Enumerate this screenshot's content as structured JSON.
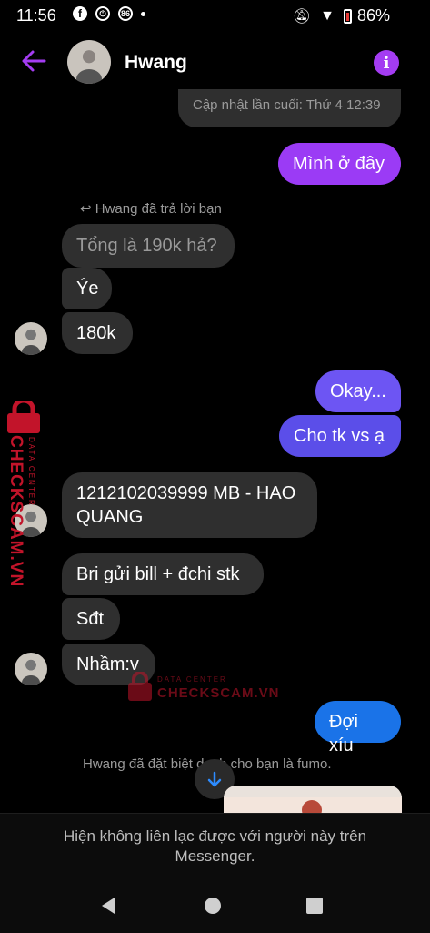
{
  "status_bar": {
    "time": "11:56",
    "badge": "86",
    "battery": "86%"
  },
  "header": {
    "contact_name": "Hwang"
  },
  "messages": {
    "last_updated": "Cập nhật lần cuối: Thứ 4 12:39",
    "m1": "Mình ở đây",
    "reply_note": "Hwang đã trả lời bạn",
    "quoted": "Tổng là 190k hả?",
    "m2": "Ýe",
    "m3": "180k",
    "m4": "Okay...",
    "m5": "Cho tk vs ạ",
    "m6_line1": "1212102039999 MB - HAO",
    "m6_line2": "QUANG",
    "m7": "Bri gửi bill + đchi stk",
    "m8": "Sđt",
    "m9": "Nhầm:v",
    "m10": "Đợi xíu",
    "nickname_note": "Hwang đã đặt biệt danh cho bạn là fumo."
  },
  "footer": {
    "notice": "Hiện không liên lạc được với người này trên Messenger."
  },
  "watermark": {
    "brand": "CHECKSCAM.VN",
    "sub": "DATA CENTER"
  },
  "colors": {
    "accent_purple": "#9b3bf5",
    "accent_indigo": "#6d55f3",
    "accent_blue": "#1a73e8",
    "incoming_bubble": "#2f2f2f",
    "watermark_red": "#c2142a"
  }
}
